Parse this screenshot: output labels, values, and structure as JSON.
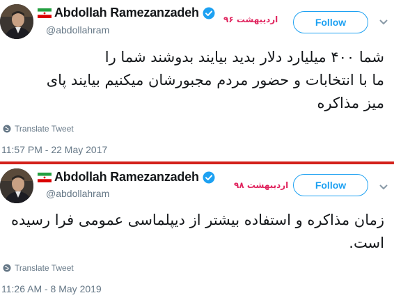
{
  "tweets": [
    {
      "display_name": "Abdollah Ramezanzadeh",
      "handle": "@abdollahram",
      "date_tag": "اردیبهشت ۹۶",
      "follow_label": "Follow",
      "text_lines": [
        "شما ۴۰۰ میلیارد دلار بدید بیایند بدوشند شما را",
        "ما با انتخابات و حضور مردم مجبورشان میکنیم بیایند پای",
        "میز مذاکره"
      ],
      "translate_label": "Translate Tweet",
      "timestamp": "11:57 PM - 22 May 2017"
    },
    {
      "display_name": "Abdollah Ramezanzadeh",
      "handle": "@abdollahram",
      "date_tag": "اردیبهشت ۹۸",
      "follow_label": "Follow",
      "text_lines": [
        "زمان مذاکره و استفاده بیشتر از دیپلماسی عمومی فرا رسیده",
        "است."
      ],
      "translate_label": "Translate Tweet",
      "timestamp": "11:26 AM - 8 May 2019"
    }
  ],
  "icons": {
    "flag": "iran-flag-icon",
    "verified": "verified-badge-icon",
    "chevron": "chevron-down-icon",
    "globe": "globe-icon"
  },
  "colors": {
    "divider": "#d3211b",
    "date_tag": "#e0245e",
    "follow": "#1da1f2",
    "verified": "#1da1f2",
    "meta_text": "#657786"
  }
}
